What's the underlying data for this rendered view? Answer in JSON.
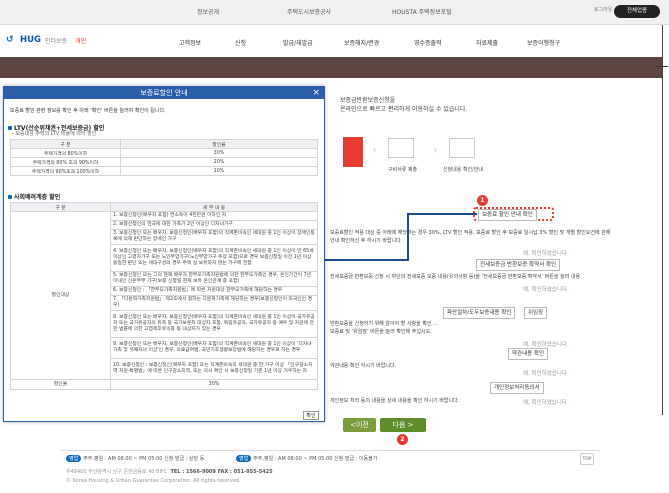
{
  "topbar": {
    "links": [
      "정보공개",
      "주택도시보증공사",
      "HOUSTA 주택정보포털"
    ],
    "login": "로그아웃",
    "cert_button": "전체업종"
  },
  "header": {
    "logo": "HUG",
    "logo_name": "안티보증",
    "logo_tag": "개인",
    "menu": [
      "고객정보",
      "신청",
      "발급/재발급",
      "보증해지/변경",
      "영수증출력",
      "자료제출",
      "보증이행청구"
    ]
  },
  "background": {
    "info_line1": "보증금반환보증신청을",
    "info_line2": "온라인으로 빠르고 편리하게 이용하실 수 있습니다.",
    "step_labels": [
      "구비서류 제출",
      "신청내용 확인/안내"
    ],
    "row1_text": "보증료할인 적용 대상 중 아래에 해당하는 경우 30%, LTV 할인 적용, 보증료 할인 후 보증료 일시납 3% 할인 및 개별 할인요건에 관해",
    "row1_text2": "안내 확인하신 후 하시기 바랍니다.",
    "discount_btn": "보증료 할인 안내 확인",
    "check_label": "예, 확인하였습니다.",
    "section2_title": "전세보증금 반환보증 확약서 확인",
    "section2_text": "전세보증금 반환보증 신청 시 하단의 전세보증 보증 내용(유의사항 등)을 ‘전세보증금 반환보증 확약서’ 버튼을 눌러 내용",
    "section3_btn": "파산절차/도두보증내용 확인",
    "section3_btn2": "위임장",
    "section3_text": "반환보증을 신청하기 위해 알아야 할 사항을 확인 ...",
    "section3_text2": "보증료 및 ‘위임장’ 버튼을 눌러 확인해 주십시오.",
    "section4_btn": "약관내용 확인",
    "section4_text": "약관내용 확인 하시기 바랍니다.",
    "section5_btn": "개인정보처리동의서",
    "section5_text": "개인정보 처리 동의 내용을 상세 내용을 확인 하시기 바랍니다.",
    "prev_btn": "<이전",
    "next_btn": "다음 >",
    "marker1": "1",
    "marker2": "2"
  },
  "footer": {
    "line1_a": "영업",
    "line1_b": "주주,평일 : AM 08:00 ~ PM 05:00   신청·발급 : 상담 등",
    "line1_c": "영업",
    "line1_d": "주주,평일 : AM 08:00 ~ PM 05:00   신청·발급 : 이동불가",
    "address": "우48400 부산광역시 남구 문현금융로 40 BIFC",
    "tel": "TEL : 1566-9009  FAX : 051-955-5425",
    "copyright": "© Korea Housing & Urban Guarantee Corporation. All rights reserved.",
    "top": "TOP"
  },
  "modal": {
    "title": "보증료할인 안내",
    "close": "×",
    "intro": "보증료 할인 관련 정보를 확인 후 아래 ‘확인’ 버튼을 눌러야 확인이 됩니다.",
    "ltv_title": "LTV(선순위채권+전세보증금) 할인",
    "ltv_sub": "- 보증대상 주택의 LTV 비율에 따라 할인",
    "ltv_headers": [
      "구 분",
      "할인율"
    ],
    "ltv_rows": [
      [
        "주택가격의 80%이하",
        "30%"
      ],
      [
        "주택가격의 80% 초과 90%이하",
        "20%"
      ],
      [
        "주택가격의 90%초과 100%이하",
        "10%"
      ]
    ],
    "social_title": "사회배려계층 할인",
    "social_headers": [
      "구 분",
      "세 부 내 용"
    ],
    "social_category": "할인대상",
    "social_items": [
      "1. 보증신청인(배우자 포함) 연소득이 4천만원 이하인 자",
      "2. 보증신청인의 한국에 대한 가족기 2인 이상인 다자녀가구",
      "3. 보증신청인 또는 배우자, 보증신청인(배우자 포함)의 직계존비속인 세대원 중 1인 이상이 장애인등록에 의해 판단하는 장애인 가구",
      "4. 보증신청인 또는 배우자, 보증신청인(배우자 포함)의 직계존비속인 세대원 중 1인 이상이 만 65세 이상인 고령자가구 또는 노인부양가구(노인부양가구 주장 포함)으로 경우 보증신청일 이전 1년 이상 동일한 판단 또는 세대구성의 경우 주택 실 보유하지 않는 가구에 한함",
      "5. 보증신청인 또는 그의 현재 배우자 한부모가족지원법에 의한 한부모가족인 경우, 혼인기간이 7년 이내인 신혼부부 가구(보증 신청일 현재 보유 혼인관계 증 포함)",
      "6. 보증신청인 : 「한부모가족지원법」에 따른 지원대상 한부모가족에 해당하는 경우",
      "7. 「다문화가족지원법」 제2조에서 정하는 다문화가족에 해당하는 경우(보증신청인이 외국인인 경우)",
      "8. 보증신청인 또는 배우자, 보증신청인(배우자 포함)의 직계존비속인 세대원 중 1인 이상이 국가유공자 또는 국가유공자의 유족 등 국가보훈처 대상자 포함, 독립유공자, 국가유공자 등 예우 및 지원에 관한 법률에 의한 고엽제후유의증 등 대상자가 있는 경우",
      "9. 보증신청인 또는 배우자, 보증신청인(배우자 포함)의 직계존비속인 세대원 중 1인 이상이 '다자녀가족 및 셋째자녀 이상'인 경우, 의료급여법, 국민기초생활보장법에 해당하는 경우로 하는 경우",
      "10. 보증신청인 : 보증신청인(배우자 포함) 또는 직계존비속의 세대원 중 한 가구 이상 「인구감소지역 지원 특별법」에 따른 인구감소지역, 또는 의사 확인 시 보증신청일 기준 1년 이상 거주하는 자"
    ],
    "social_rate_label": "할인율",
    "social_rate": "30%",
    "ok": "확인"
  }
}
